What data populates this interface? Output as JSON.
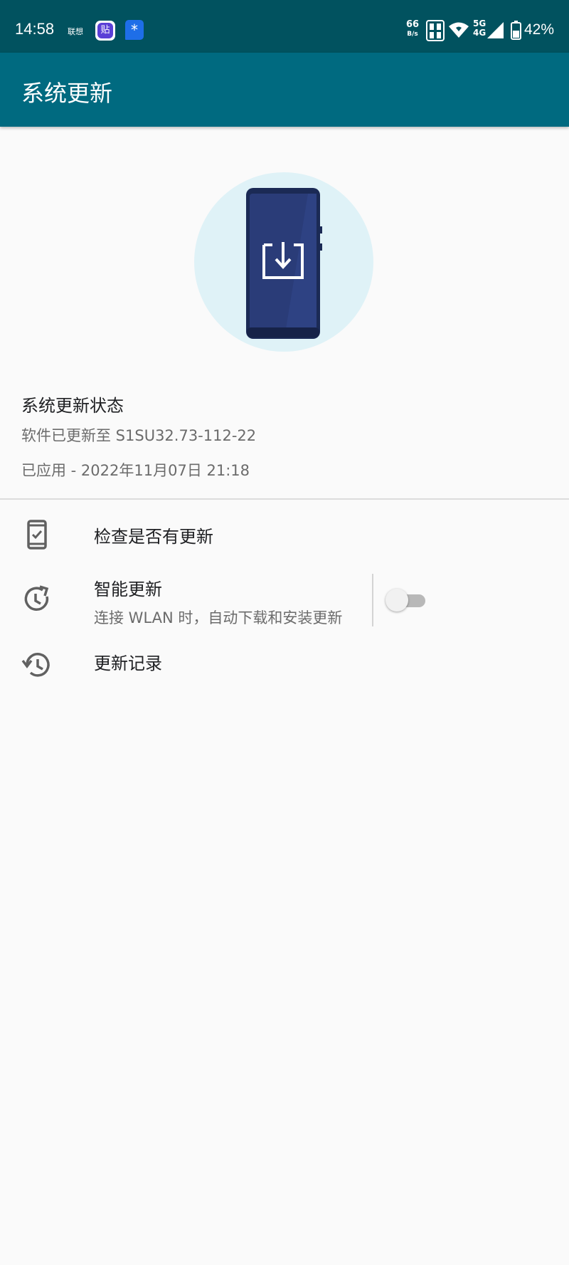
{
  "status_bar": {
    "time": "14:58",
    "carrier": "联想",
    "app_icon_1": "贴",
    "app_icon_2": "*",
    "net_speed_value": "66",
    "net_speed_unit": "B/s",
    "network_top": "5G",
    "network_bottom": "4G",
    "battery_percent": "42%",
    "icons": [
      "tieba-app-icon",
      "star-app-icon",
      "hd-icon",
      "wifi-icon",
      "signal-icon",
      "battery-icon"
    ]
  },
  "app_bar": {
    "title": "系统更新"
  },
  "hero": {
    "illustration": "phone-download-illustration",
    "circle_color": "#dff2f7",
    "phone_color": "#24346a"
  },
  "update_status": {
    "title": "系统更新状态",
    "version_text": "软件已更新至 S1SU32.73-112-22",
    "applied_text": "已应用 - 2022年11月07日 21:18"
  },
  "menu": {
    "check_updates": {
      "label": "检查是否有更新",
      "icon": "phone-check-icon"
    },
    "smart_update": {
      "label": "智能更新",
      "subtitle": "连接 WLAN 时，自动下载和安装更新",
      "icon": "clock-refresh-icon",
      "enabled": false
    },
    "update_history": {
      "label": "更新记录",
      "icon": "history-icon"
    }
  },
  "colors": {
    "status_bar": "#01525f",
    "app_bar": "#006a80",
    "background": "#fafafa"
  }
}
